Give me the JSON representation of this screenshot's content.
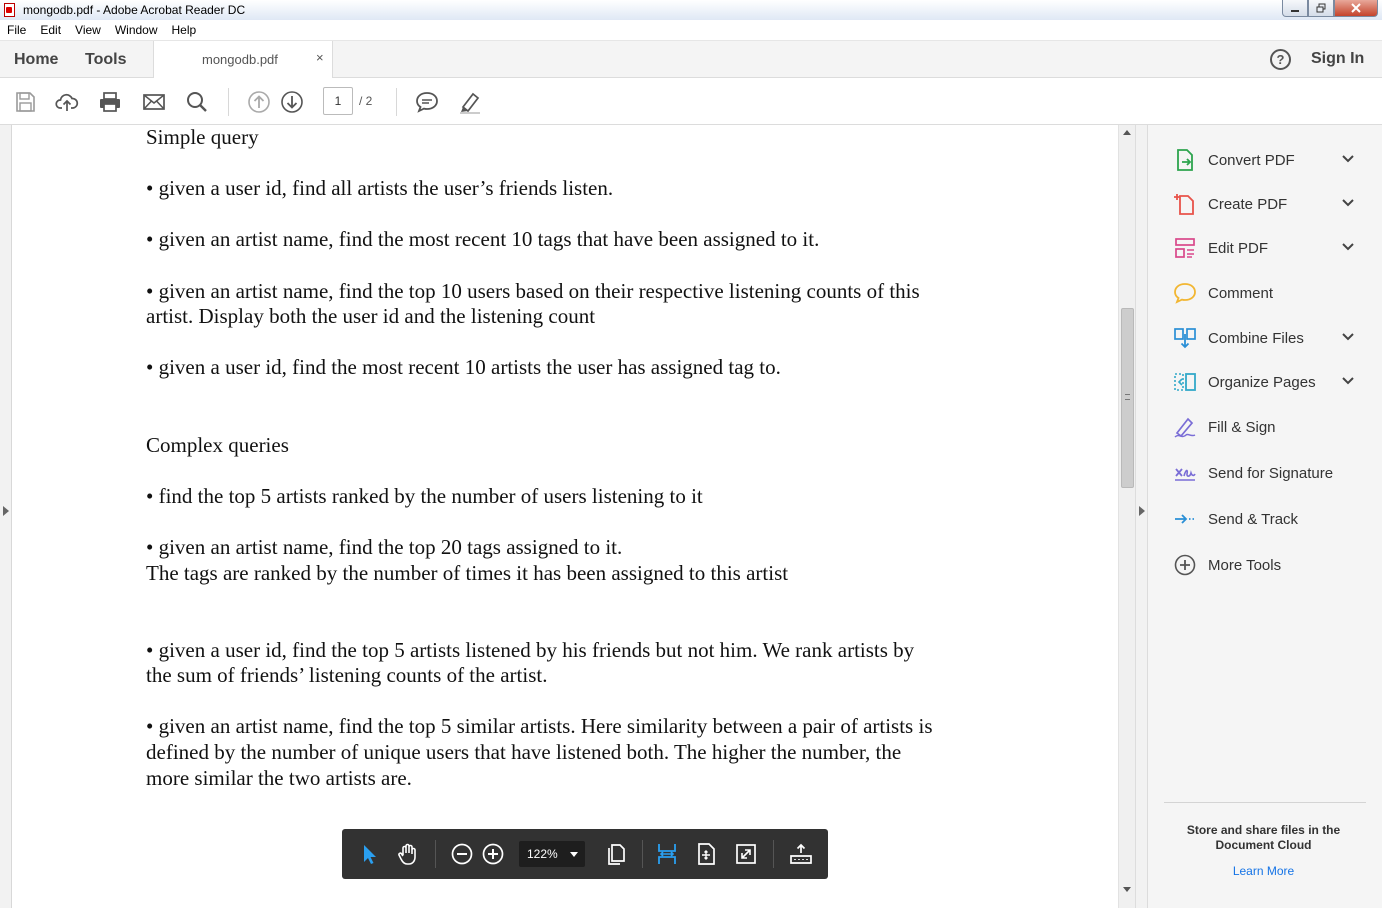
{
  "window": {
    "title": "mongodb.pdf - Adobe Acrobat Reader DC"
  },
  "menu": [
    "File",
    "Edit",
    "View",
    "Window",
    "Help"
  ],
  "tabs": {
    "home": "Home",
    "tools": "Tools",
    "document": "mongodb.pdf",
    "close_glyph": "×"
  },
  "header": {
    "sign_in": "Sign In",
    "help_glyph": "?"
  },
  "toolbar": {
    "current_page": "1",
    "page_total": "/ 2"
  },
  "document": {
    "lines": [
      "Simple query",
      "• given a user id, find all artists the user’s friends listen.",
      "• given an artist name, find the most recent 10 tags that have been assigned to it.",
      "• given an artist name, find the top 10 users based on their respective listening counts of this",
      "artist. Display both the user id and the listening count",
      "• given a user id, find the most recent 10 artists the user has assigned tag to.",
      " Complex queries",
      "• find the top 5 artists ranked by the number of users listening to it",
      "• given an artist name, find the top 20 tags assigned to it.",
      "The tags are ranked by the number of times it has been assigned to this artist",
      " • given a user id, find the top 5 artists listened by his friends but not him. We rank artists by",
      "the sum of friends’ listening counts of the artist.",
      "• given an artist name, find the top 5 similar artists. Here similarity between a pair of artists is",
      "defined by the number of unique users that have listened both. The higher the number, the",
      "more similar the two artists are."
    ]
  },
  "tools_pane": {
    "items": [
      {
        "label": "Convert PDF",
        "icon": "convert-pdf-icon",
        "expandable": true,
        "color": "#2da44e"
      },
      {
        "label": "Create PDF",
        "icon": "create-pdf-icon",
        "expandable": true,
        "color": "#e8534a"
      },
      {
        "label": "Edit PDF",
        "icon": "edit-pdf-icon",
        "expandable": true,
        "color": "#d9488b"
      },
      {
        "label": "Comment",
        "icon": "comment-icon",
        "expandable": false,
        "color": "#f2b632"
      },
      {
        "label": "Combine Files",
        "icon": "combine-files-icon",
        "expandable": true,
        "color": "#2a8fd6"
      },
      {
        "label": "Organize Pages",
        "icon": "organize-pages-icon",
        "expandable": true,
        "color": "#33a9c9"
      },
      {
        "label": "Fill & Sign",
        "icon": "fill-sign-icon",
        "expandable": false,
        "color": "#7a6dd6"
      },
      {
        "label": "Send for Signature",
        "icon": "send-signature-icon",
        "expandable": false,
        "color": "#7a6dd6"
      },
      {
        "label": "Send & Track",
        "icon": "send-track-icon",
        "expandable": false,
        "color": "#2a8fd6"
      },
      {
        "label": "More Tools",
        "icon": "more-tools-icon",
        "expandable": false,
        "color": "#555555"
      }
    ],
    "cloud_text": "Store and share files in the\nDocument Cloud",
    "learn_more": "Learn More"
  },
  "zoom_bar": {
    "zoom": "122%",
    "accent": "#2a9ff0"
  }
}
